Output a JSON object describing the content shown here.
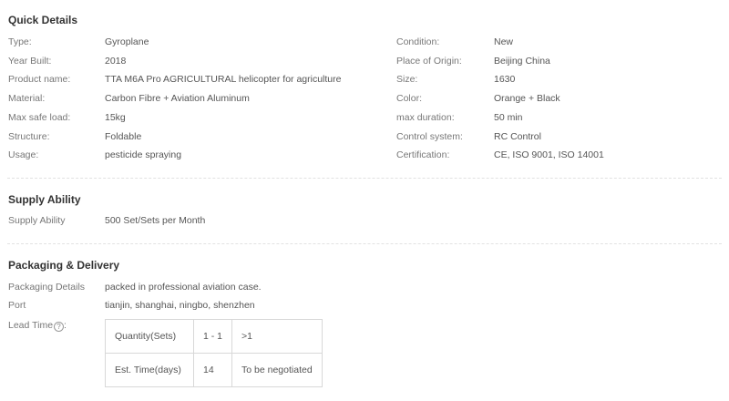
{
  "quick_details": {
    "title": "Quick Details",
    "left": [
      {
        "label": "Type:",
        "value": "Gyroplane"
      },
      {
        "label": "Year Built:",
        "value": "2018"
      },
      {
        "label": "Product name:",
        "value": "TTA M6A Pro AGRICULTURAL helicopter for agriculture"
      },
      {
        "label": "Material:",
        "value": "Carbon Fibre + Aviation Aluminum"
      },
      {
        "label": "Max safe load:",
        "value": "15kg"
      },
      {
        "label": "Structure:",
        "value": "Foldable"
      },
      {
        "label": "Usage:",
        "value": "pesticide spraying"
      }
    ],
    "right": [
      {
        "label": "Condition:",
        "value": "New"
      },
      {
        "label": "Place of Origin:",
        "value": "Beijing China"
      },
      {
        "label": "Size:",
        "value": "1630"
      },
      {
        "label": "Color:",
        "value": "Orange + Black"
      },
      {
        "label": "max duration:",
        "value": "50 min"
      },
      {
        "label": "Control system:",
        "value": "RC Control"
      },
      {
        "label": "Certification:",
        "value": "CE, ISO 9001, ISO 14001"
      }
    ]
  },
  "supply_ability": {
    "title": "Supply Ability",
    "label": "Supply Ability",
    "value": "500 Set/Sets per Month"
  },
  "packaging": {
    "title": "Packaging & Delivery",
    "details_label": "Packaging Details",
    "details_value": "packed in professional aviation case.",
    "port_label": "Port",
    "port_value": "tianjin, shanghai, ningbo, shenzhen",
    "lead_time_label": "Lead Time",
    "help_icon": "question-circle-icon",
    "lead_table": [
      [
        "Quantity(Sets)",
        "1 - 1",
        ">1"
      ],
      [
        "Est. Time(days)",
        "14",
        "To be negotiated"
      ]
    ]
  }
}
